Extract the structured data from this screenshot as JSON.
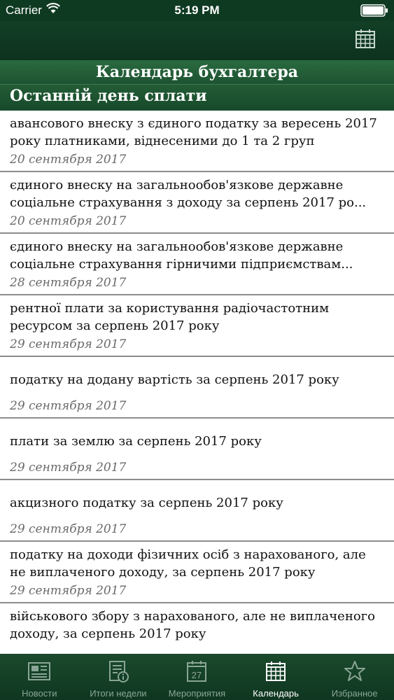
{
  "status": {
    "carrier": "Carrier",
    "time": "5:19 PM"
  },
  "header": {
    "title": "Календарь бухгалтера",
    "section": "Останній день сплати"
  },
  "items": [
    {
      "title": "авансового внеску з єдиного податку за вересень 2017 року платниками, віднесеними до 1 та 2 груп",
      "date": "20 сентября 2017"
    },
    {
      "title": "єдиного внеску на загальнообов'язкове державне соціальне страхування з доходу за серпень 2017 ро...",
      "date": "20 сентября 2017"
    },
    {
      "title": "єдиного внеску на загальнообов'язкове державне соціальне страхування гірничими підприємствам...",
      "date": "28 сентября 2017"
    },
    {
      "title": "рентної плати за користування радіочастотним ресурсом за серпень 2017 року",
      "date": "29 сентября 2017"
    },
    {
      "title": "податку на додану вартість за серпень 2017 року",
      "date": "29 сентября 2017"
    },
    {
      "title": "плати за землю за серпень 2017 року",
      "date": "29 сентября 2017"
    },
    {
      "title": "акцизного податку за серпень 2017 року",
      "date": "29 сентября 2017"
    },
    {
      "title": "податку на доходи фізичних осіб з нарахованого, але не виплаченого доходу, за серпень 2017 року",
      "date": "29 сентября 2017"
    },
    {
      "title": "військового збору з нарахованого, але не виплаченого доходу, за серпень 2017 року",
      "date": ""
    }
  ],
  "tabs": [
    {
      "label": "Новости",
      "icon": "newspaper-icon"
    },
    {
      "label": "Итоги недели",
      "icon": "document-info-icon"
    },
    {
      "label": "Мероприятия",
      "icon": "calendar-day-icon",
      "day": "27"
    },
    {
      "label": "Календарь",
      "icon": "calendar-grid-icon"
    },
    {
      "label": "Избранное",
      "icon": "star-icon"
    }
  ],
  "colors": {
    "bar": "#0f3a22",
    "accent": "#235c36",
    "tab_inactive": "#8aa595",
    "tab_active": "#ffffff"
  }
}
